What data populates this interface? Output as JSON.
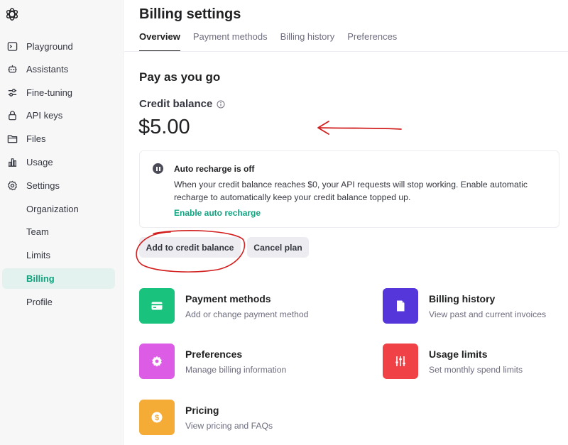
{
  "sidebar": {
    "items": [
      {
        "label": "Playground",
        "icon": "terminal-icon"
      },
      {
        "label": "Assistants",
        "icon": "robot-icon"
      },
      {
        "label": "Fine-tuning",
        "icon": "sliders-icon"
      },
      {
        "label": "API keys",
        "icon": "lock-icon"
      },
      {
        "label": "Files",
        "icon": "folder-icon"
      },
      {
        "label": "Usage",
        "icon": "bar-chart-icon"
      },
      {
        "label": "Settings",
        "icon": "gear-icon"
      }
    ],
    "subitems": [
      {
        "label": "Organization"
      },
      {
        "label": "Team"
      },
      {
        "label": "Limits"
      },
      {
        "label": "Billing",
        "active": true
      },
      {
        "label": "Profile"
      }
    ]
  },
  "header": {
    "title": "Billing settings",
    "tabs": [
      "Overview",
      "Payment methods",
      "Billing history",
      "Preferences"
    ],
    "active_tab": "Overview"
  },
  "main": {
    "section_title": "Pay as you go",
    "credit_label": "Credit balance",
    "balance": "$5.00",
    "alert": {
      "title": "Auto recharge is off",
      "body": "When your credit balance reaches $0, your API requests will stop working. Enable automatic recharge to automatically keep your credit balance topped up.",
      "link": "Enable auto recharge"
    },
    "buttons": {
      "add": "Add to credit balance",
      "cancel": "Cancel plan"
    },
    "cards": [
      {
        "title": "Payment methods",
        "subtitle": "Add or change payment method",
        "color": "#19c37d",
        "icon": "credit-card-icon"
      },
      {
        "title": "Billing history",
        "subtitle": "View past and current invoices",
        "color": "#5436da",
        "icon": "document-icon"
      },
      {
        "title": "Preferences",
        "subtitle": "Manage billing information",
        "color": "#dd5ce5",
        "icon": "gear-icon"
      },
      {
        "title": "Usage limits",
        "subtitle": "Set monthly spend limits",
        "color": "#ef4146",
        "icon": "sliders-icon"
      },
      {
        "title": "Pricing",
        "subtitle": "View pricing and FAQs",
        "color": "#f4ac36",
        "icon": "dollar-icon"
      }
    ]
  },
  "colors": {
    "accent": "#10a37f",
    "annotation": "#d21f1f"
  }
}
